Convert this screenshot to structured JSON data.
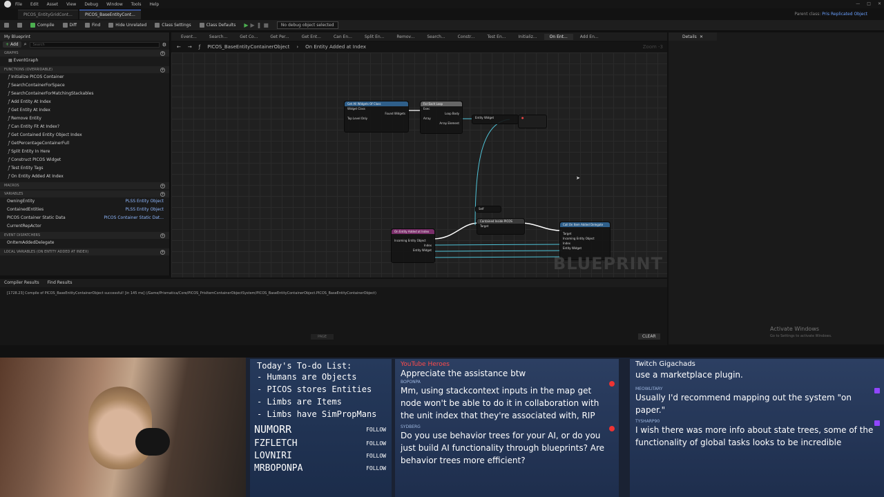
{
  "menu": [
    "File",
    "Edit",
    "Asset",
    "View",
    "Debug",
    "Window",
    "Tools",
    "Help"
  ],
  "tabs": [
    {
      "label": "PICOS_EntityGridCont...",
      "active": false
    },
    {
      "label": "PICOS_BaseEntityCont...",
      "active": true
    }
  ],
  "parent_class": {
    "label": "Parent class:",
    "value": "Pris Replicated Object"
  },
  "toolbar": {
    "compile": "Compile",
    "diff": "Diff",
    "find": "Find",
    "hide_unrelated": "Hide Unrelated",
    "class_settings": "Class Settings",
    "class_defaults": "Class Defaults",
    "debug_select": "No debug object selected"
  },
  "left": {
    "title": "My Blueprint",
    "add": "Add",
    "search_placeholder": "Search",
    "sections": {
      "graphs": "GRAPHS",
      "functions": "FUNCTIONS (OVERRIDABLE)",
      "macros": "MACROS",
      "variables": "VARIABLES",
      "dispatchers": "EVENT DISPATCHERS",
      "local": "LOCAL VARIABLES (ON ENTITY ADDED AT INDEX)"
    },
    "graphs": [
      "EventGraph"
    ],
    "functions": [
      "Initialize PICOS Container",
      "SearchContainerForSpace",
      "SearchContainerForMatchingStackables",
      "Add Entity At Index",
      "Get Entity At Index",
      "Remove Entity",
      "Can Entity Fit At Index?",
      "Get Contained Entity Object Index",
      "GetPercentageContainerFull",
      "Split Entity In Here",
      "Construct PICOS Widget",
      "Test Entity Tags",
      "On Entity Added At Index"
    ],
    "variables": [
      {
        "name": "OwningEntity",
        "type": "PLSS Entity Object"
      },
      {
        "name": "ContainedEntities",
        "type": "PLSS Entity Object"
      },
      {
        "name": "PICOS Container Static Data",
        "type": "PICOS Container Static Dat..."
      },
      {
        "name": "CurrentRepActor",
        "type": ""
      }
    ],
    "dispatchers": [
      "OnItemAddedDelegate"
    ]
  },
  "graph_tabs": [
    "Event...",
    "Search...",
    "Get Co...",
    "Get Per...",
    "Get Ent...",
    "Can En...",
    "Split En...",
    "Remov...",
    "Search...",
    "Constr...",
    "Test En...",
    "Initializ...",
    "On Ent...",
    "Add En..."
  ],
  "breadcrumb": {
    "root": "PICOS_BaseEntityContainerObject",
    "current": "On Entity Added at Index",
    "zoom": "Zoom -3"
  },
  "nodes": {
    "n1": {
      "title": "Get All Widgets Of Class",
      "pins": [
        "Widget Class",
        "Found Widgets",
        "Top Level Only"
      ]
    },
    "n2": {
      "title": "For Each Loop",
      "pins": [
        "Exec",
        "Loop Body",
        "Array",
        "Array Element",
        "Array Index",
        "Completed"
      ]
    },
    "n3": {
      "title": "Entity Widget",
      "pins": [
        "Target"
      ]
    },
    "n5": {
      "title": "On Entity Added at Index",
      "pins": [
        "Incoming Entity Object",
        "Index",
        "Entity Widget"
      ]
    },
    "n6": {
      "title": "Contained Inside PICOS",
      "pins": [
        "Target"
      ]
    },
    "n7": {
      "title": "Call On Item Added Delegate",
      "pins": [
        "Target",
        "Incoming Entity Object",
        "Index",
        "Entity Widget"
      ]
    }
  },
  "watermark": "BLUEPRINT",
  "details": {
    "title": "Details"
  },
  "activate": {
    "title": "Activate Windows",
    "sub": "Go to Settings to activate Windows."
  },
  "bottom": {
    "tabs": [
      "Compiler Results",
      "Find Results"
    ],
    "message": "[1728.23] Compile of PICOS_BaseEntityContainerObject successful! [in 145 ms] (/Game/Prismatica/Core/PICOS_PrisItemContainerObjectSystem/PICOS_BaseEntityContainerObject.PICOS_BaseEntityContainerObject)",
    "page": "PAGE",
    "clear": "CLEAR"
  },
  "todo": {
    "title": "Today's To-do List:",
    "items": [
      "- Humans are Objects",
      "- PICOS stores Entities",
      "- Limbs are Items",
      "- Limbs have SimPropMans"
    ],
    "followers": [
      "NUMORR",
      "FZFLETCH",
      "LOVNIRI",
      "MRBOPONPA"
    ],
    "follow": "FOLLOW"
  },
  "chat_youtube": {
    "header": "YouTube Heroes",
    "cut": "Appreciate the assistance btw",
    "messages": [
      {
        "who": "BOPONPA",
        "text": "Mm, using stackcontext inputs in the map get node won't be able to do it in collaboration with the unit index that they're associated with, RIP"
      },
      {
        "who": "SYDBERG",
        "text": "Do you use behavior trees for your AI, or do you just build AI functionality through blueprints? Are behavior trees more efficient?"
      }
    ]
  },
  "chat_twitch": {
    "header": "Twitch Gigachads",
    "cut": "use a marketplace plugin.",
    "messages": [
      {
        "who": "MEOWLITARY",
        "text": "Usually I'd recommend mapping out the system \"on paper.\""
      },
      {
        "who": "TYSHARP90",
        "text": "I wish there was more info about state trees, some of the functionality of global tasks looks to be incredible"
      }
    ]
  },
  "colors": {
    "accent": "#4b7fff",
    "youtube": "#ff4b4b",
    "exec_line": "#ffffff",
    "data_line": "#4fc3d8"
  }
}
